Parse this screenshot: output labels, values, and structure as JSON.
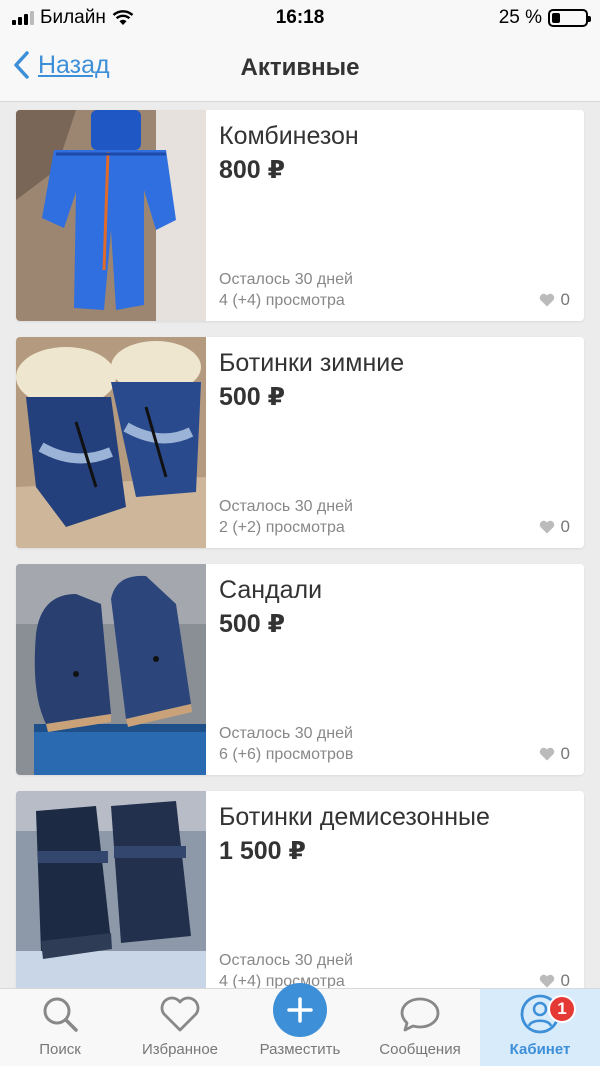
{
  "status_bar": {
    "carrier": "Билайн",
    "time": "16:18",
    "battery": "25 %",
    "battery_level": 0.25
  },
  "nav": {
    "back_label": "Назад",
    "title": "Активные"
  },
  "listings": [
    {
      "title": "Комбинезон",
      "price": "800 ₽",
      "remaining": "Осталось 30 дней",
      "views": "4 (+4) просмотра",
      "likes": "0"
    },
    {
      "title": "Ботинки зимние",
      "price": "500 ₽",
      "remaining": "Осталось 30 дней",
      "views": "2 (+2) просмотра",
      "likes": "0"
    },
    {
      "title": "Сандали",
      "price": "500 ₽",
      "remaining": "Осталось 30 дней",
      "views": "6 (+6) просмотров",
      "likes": "0"
    },
    {
      "title": "Ботинки демисезонные",
      "price": "1 500 ₽",
      "remaining": "Осталось 30 дней",
      "views": "4 (+4) просмотра",
      "likes": "0"
    }
  ],
  "tabs": [
    {
      "label": "Поиск",
      "icon": "search-icon"
    },
    {
      "label": "Избранное",
      "icon": "heart-icon"
    },
    {
      "label": "Разместить",
      "icon": "plus-icon"
    },
    {
      "label": "Сообщения",
      "icon": "chat-bubble-icon"
    },
    {
      "label": "Кабинет",
      "icon": "user-icon",
      "badge": "1"
    }
  ],
  "colors": {
    "accent": "#3d8fd8",
    "badge": "#e53935",
    "active_tab_bg": "#d8ebfb"
  }
}
